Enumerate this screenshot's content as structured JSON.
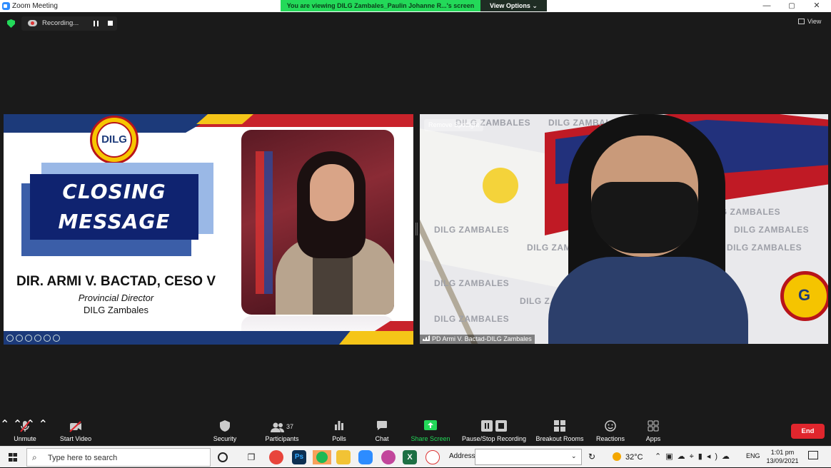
{
  "window": {
    "title": "Zoom Meeting",
    "minimize": "—",
    "maximize": "▢",
    "close": "✕"
  },
  "banner": {
    "text": "You are viewing DILG Zambales_Paulin Johanne R...'s screen",
    "view_options": "View Options ⌄"
  },
  "recording": {
    "label": "Recording..."
  },
  "view_button": {
    "label": "View"
  },
  "slide": {
    "seal_text": "DILG",
    "closing_line1": "CLOSING",
    "closing_line2": "MESSAGE",
    "name": "DIR. ARMI V. BACTAD, CESO V",
    "role": "Provincial Director",
    "org": "DILG Zambales"
  },
  "video": {
    "remove_spotlight": "Remove Spotlight",
    "participant_name": "PD Armi V. Bactad-DILG Zambales",
    "watermarks": [
      "DILG ZAMBALES",
      "DILG ZAMBALES",
      "DILG ZAMBALES",
      "DILG ZAMBALES",
      "ES",
      "DILG ZAMBALES",
      "DILG ZAMBALES",
      "DILG ZAMBALES",
      "DILG ZAMBALES",
      "DILG ZAMBALES",
      "DILG ZAMBALES"
    ],
    "seal_letter": "G"
  },
  "toolbar": {
    "unmute": "Unmute",
    "start_video": "Start Video",
    "security": "Security",
    "participants": "Participants",
    "participant_count": "37",
    "polls": "Polls",
    "chat": "Chat",
    "share_screen": "Share Screen",
    "pause_stop_recording": "Pause/Stop Recording",
    "breakout_rooms": "Breakout Rooms",
    "reactions": "Reactions",
    "apps": "Apps",
    "end": "End"
  },
  "taskbar": {
    "search_placeholder": "Type here to search",
    "address_label": "Address",
    "temperature": "32°C",
    "language": "ENG",
    "time": "1:01 pm",
    "date": "13/09/2021",
    "apps": [
      {
        "name": "chrome",
        "color": "#e8453c"
      },
      {
        "name": "photoshop",
        "color": "#0c2f52",
        "label": "Ps"
      },
      {
        "name": "spotify",
        "color": "#1db954"
      },
      {
        "name": "file-explorer",
        "color": "#f2c335"
      },
      {
        "name": "zoom",
        "color": "#2d8cff"
      },
      {
        "name": "chrome-profile",
        "color": "#c2469b"
      },
      {
        "name": "excel",
        "color": "#1d7044",
        "label": "X"
      },
      {
        "name": "paint",
        "color": "#ffffff"
      }
    ]
  }
}
